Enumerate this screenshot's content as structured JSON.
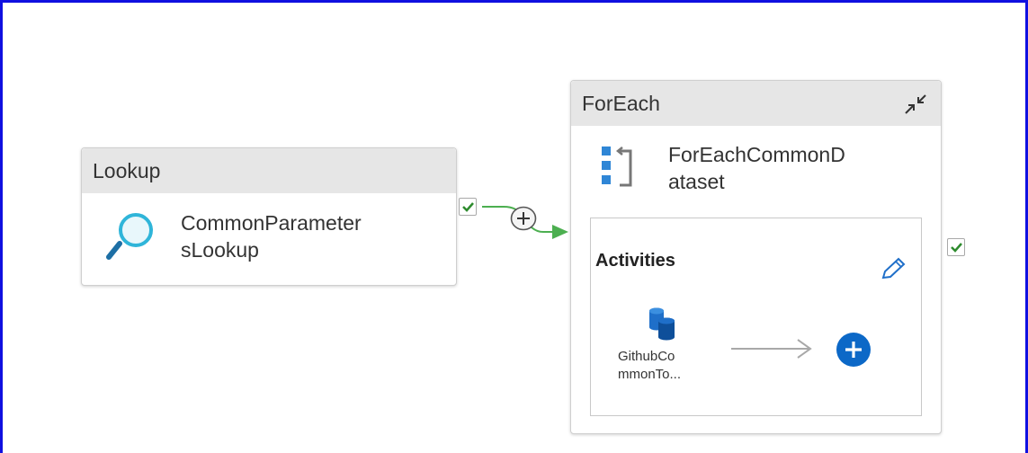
{
  "lookup": {
    "type_label": "Lookup",
    "name": "CommonParameter\nsLookup",
    "icon": "search-icon"
  },
  "foreach": {
    "type_label": "ForEach",
    "name": "ForEachCommonD\nataset",
    "icon": "foreach-icon",
    "collapse_icon": "collapse-icon",
    "activities_label": "Activities",
    "edit_icon": "pencil-icon",
    "child": {
      "name": "GithubCo\nmmonTo...",
      "icon": "database-icon"
    },
    "add_icon": "add-activity-icon"
  },
  "connector": {
    "add_icon": "plus-circle-icon",
    "color": "#4caf50"
  },
  "colors": {
    "accent": "#0078d4",
    "header_bg": "#e6e6e6",
    "success": "#2e8b2e",
    "frame_border": "#1010e0"
  }
}
